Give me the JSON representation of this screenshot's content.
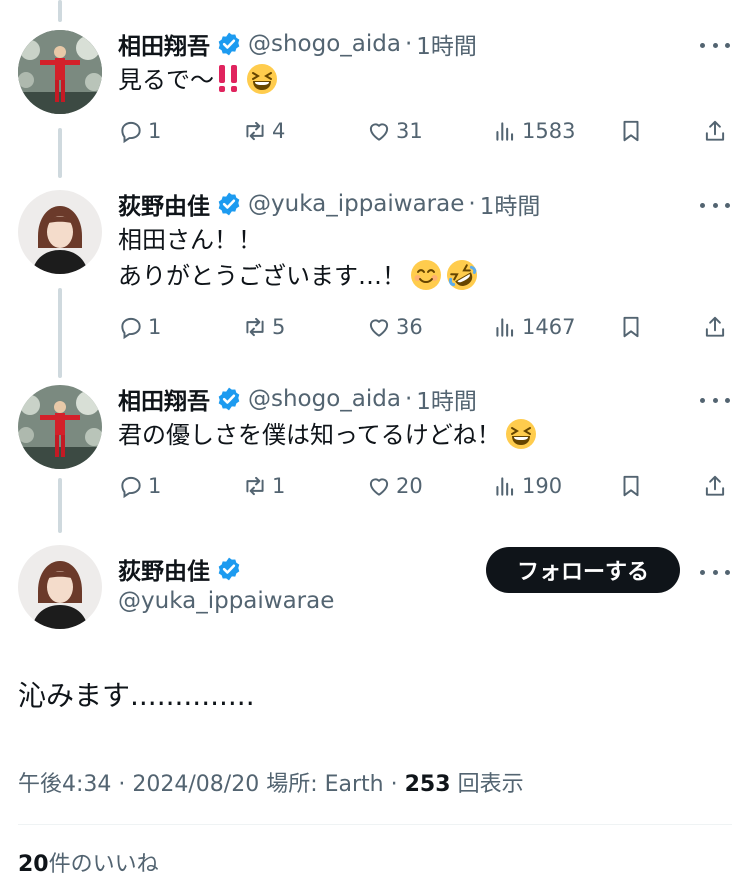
{
  "replies": [
    {
      "name": "相田翔吾",
      "handle": "@shogo_aida",
      "separator": "·",
      "time": "1時間",
      "text_lines": [
        "見るで〜"
      ],
      "emojis": [
        "double-exclamation",
        "grinning-squinting-face"
      ],
      "stats": {
        "replies": "1",
        "reposts": "4",
        "likes": "31",
        "views": "1583"
      }
    },
    {
      "name": "荻野由佳",
      "handle": "@yuka_ippaiwarae",
      "separator": "·",
      "time": "1時間",
      "text_lines": [
        "相田さん！！",
        "ありがとうございます…！"
      ],
      "emojis": [
        "smiling-face-with-smiling-eyes",
        "rolling-on-the-floor-laughing"
      ],
      "stats": {
        "replies": "1",
        "reposts": "5",
        "likes": "36",
        "views": "1467"
      }
    },
    {
      "name": "相田翔吾",
      "handle": "@shogo_aida",
      "separator": "·",
      "time": "1時間",
      "text_lines": [
        "君の優しさを僕は知ってるけどね！"
      ],
      "emojis": [
        "grinning-squinting-face"
      ],
      "stats": {
        "replies": "1",
        "reposts": "1",
        "likes": "20",
        "views": "190"
      }
    }
  ],
  "main_post": {
    "name": "荻野由佳",
    "handle": "@yuka_ippaiwarae",
    "follow_label": "フォローする",
    "text": "沁みます..............",
    "time": "午後4:34",
    "date": "2024/08/20",
    "location_label": "場所: Earth",
    "views_count": "253",
    "views_label": "回表示",
    "likes_count": "20",
    "likes_label": "件のいいね"
  },
  "icons": {
    "reply": "comment-bubble-icon",
    "repost": "repost-arrows-icon",
    "like": "heart-icon",
    "views": "bar-chart-icon",
    "bookmark": "bookmark-icon",
    "share": "share-upload-icon",
    "verified": "verified-badge-icon",
    "more": "more-dots-icon"
  },
  "colors": {
    "text_primary": "#0f1419",
    "text_secondary": "#536471",
    "verified_blue": "#1d9bf0",
    "thread_line": "#cfd9de",
    "follow_button_bg": "#0f1419",
    "exclamation_red": "#e0245e"
  }
}
